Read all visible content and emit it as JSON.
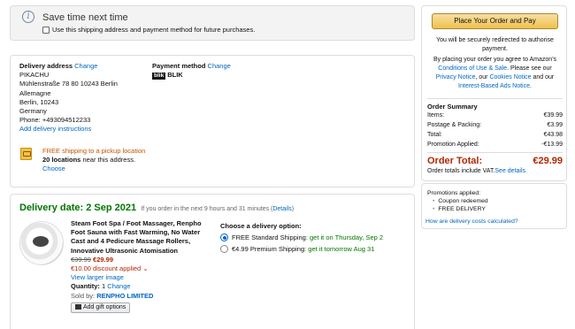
{
  "save_box": {
    "icon": "info-icon",
    "title": "Save time next time",
    "checkbox_label": "Use this shipping address and payment method for future purchases.",
    "checked": false
  },
  "address": {
    "label": "Delivery address",
    "change": "Change",
    "lines": [
      "PIKACHU",
      "Mühlenstraße 78 80 10243 Berlin",
      "Allemagne",
      "Berlin, 10243",
      "Germany",
      "Phone: +493094512233"
    ],
    "instructions_link": "Add delivery instructions"
  },
  "payment": {
    "label": "Payment method",
    "change": "Change",
    "logo_text": "blik",
    "method": "BLIK"
  },
  "pickup": {
    "icon": "pickup-location-icon",
    "offer": "FREE shipping to a pickup location",
    "count": "20 locations",
    "suffix": " near this address.",
    "choose": "Choose"
  },
  "delivery": {
    "date": "Delivery date: 2 Sep 2021",
    "note": "If you order in the next 9 hours and 31 minutes (",
    "details_link": "Details",
    "note_end": ")"
  },
  "product": {
    "title": "Steam Foot Spa / Foot Massager, Renpho Foot Sauna with Fast Warming, No Water Cast and 4 Pedicure Massage Rollers, Innovative Ultrasonic Atomisation",
    "old_price": "€39.99",
    "new_price": "€29.99",
    "discount": "€10.00 discount applied ⌄",
    "larger_image": "View larger image",
    "quantity_label": "Quantity:",
    "quantity": "1",
    "quantity_change": "Change",
    "sold_by": "Sold by:",
    "seller": "RENPHO LIMITED",
    "gift_button": "Add gift options"
  },
  "shipping": {
    "heading": "Choose a delivery option:",
    "options": [
      {
        "label": "FREE Standard Shipping",
        "eta": ": get it on Thursday, Sep 2",
        "selected": true
      },
      {
        "label": "€4.99 Premium Shipping",
        "eta": ": get it tomorrow Aug 31",
        "selected": false
      }
    ]
  },
  "summary": {
    "place_order": "Place Your Order and Pay",
    "redirect_note": "You will be securely redirected to authorise payment.",
    "legal_prefix": "By placing your order you agree to Amazon's",
    "legal_link1": "Conditions of Use & Sale",
    "legal_mid1": ". Please see our",
    "legal_link2": "Privacy Notice",
    "legal_mid2": ", our",
    "legal_link3": "Cookies Notice",
    "legal_mid3": "and our",
    "legal_link4": "Interest-Based Ads Notice",
    "legal_end": ".",
    "title": "Order Summary",
    "rows": [
      {
        "label": "Items:",
        "value": "€39.99"
      },
      {
        "label": "Postage & Packing:",
        "value": "€3.99"
      },
      {
        "label": "Total:",
        "value": "€43.98"
      },
      {
        "label": "Promotion Applied:",
        "value": "-€13.99"
      }
    ],
    "order_total_label": "Order Total:",
    "order_total_value": "€29.99",
    "vat_note": "Order totals include VAT.",
    "vat_link": "See details."
  },
  "promotions": {
    "title": "Promotions applied:",
    "items": [
      "Coupon redeemed",
      "FREE DELIVERY"
    ],
    "delivery_costs_link": "How are delivery costs calculated?"
  },
  "colors": {
    "link": "#0066c0",
    "price_red": "#b12704",
    "delivery_green": "#007600",
    "button_yellow": "#f0c14b"
  }
}
